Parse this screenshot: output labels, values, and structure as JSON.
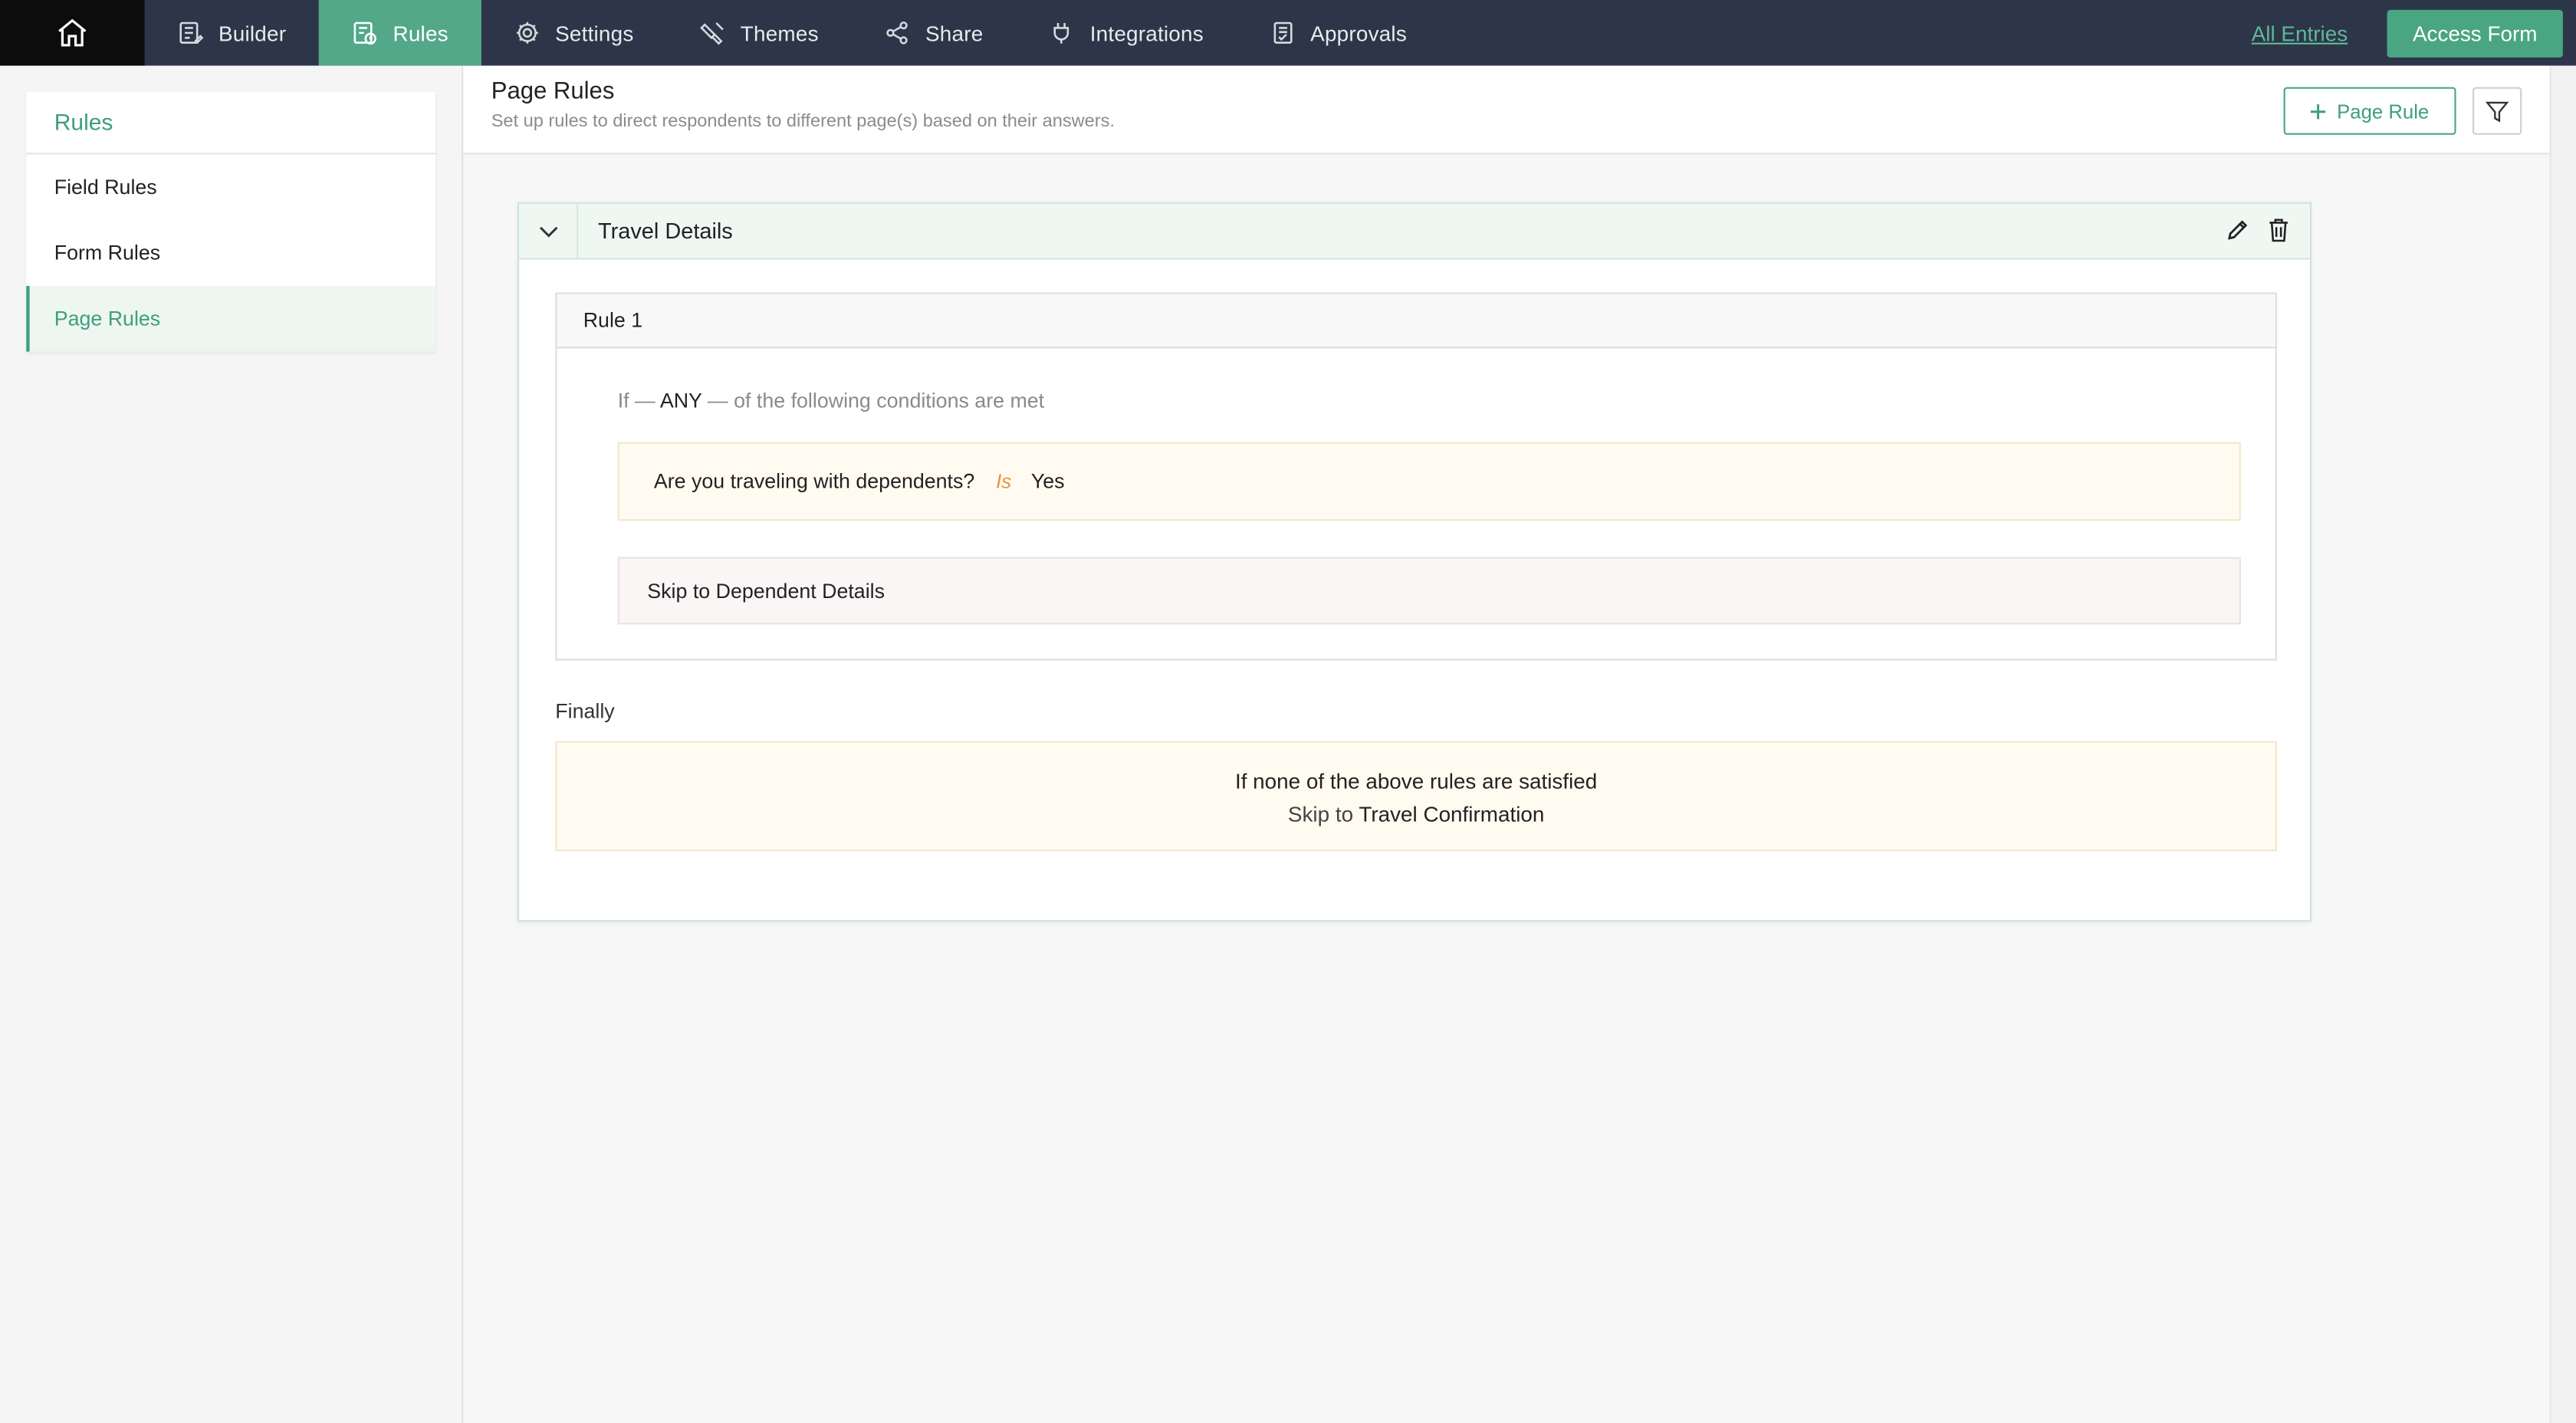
{
  "nav": {
    "items": [
      {
        "label": "Builder",
        "icon": "builder-icon"
      },
      {
        "label": "Rules",
        "icon": "rules-icon",
        "active": true
      },
      {
        "label": "Settings",
        "icon": "gear-icon"
      },
      {
        "label": "Themes",
        "icon": "paint-icon"
      },
      {
        "label": "Share",
        "icon": "share-icon"
      },
      {
        "label": "Integrations",
        "icon": "plug-icon"
      },
      {
        "label": "Approvals",
        "icon": "approvals-icon"
      }
    ],
    "all_entries": "All Entries",
    "access_form": "Access Form"
  },
  "sidebar": {
    "title": "Rules",
    "items": [
      {
        "label": "Field Rules"
      },
      {
        "label": "Form Rules"
      },
      {
        "label": "Page Rules",
        "active": true
      }
    ]
  },
  "header": {
    "title": "Page Rules",
    "subtitle": "Set up rules to direct respondents to different page(s) based on their answers.",
    "add_button": "Page Rule"
  },
  "page_rule": {
    "title": "Travel Details",
    "rule": {
      "name": "Rule 1",
      "cond_if": "If —",
      "cond_any": "ANY",
      "cond_rest": "—  of the following conditions are met",
      "condition": {
        "field": "Are you traveling with dependents?",
        "operator": "Is",
        "value": "Yes"
      },
      "action": "Skip to Dependent Details"
    },
    "finally": {
      "label": "Finally",
      "line1": "If none of the above rules are satisfied",
      "skip_prefix": "Skip to",
      "target": "Travel Confirmation"
    }
  },
  "colors": {
    "nav_bg": "#2d3648",
    "accent": "#4aa583",
    "home_bg": "#0c0c0c"
  }
}
